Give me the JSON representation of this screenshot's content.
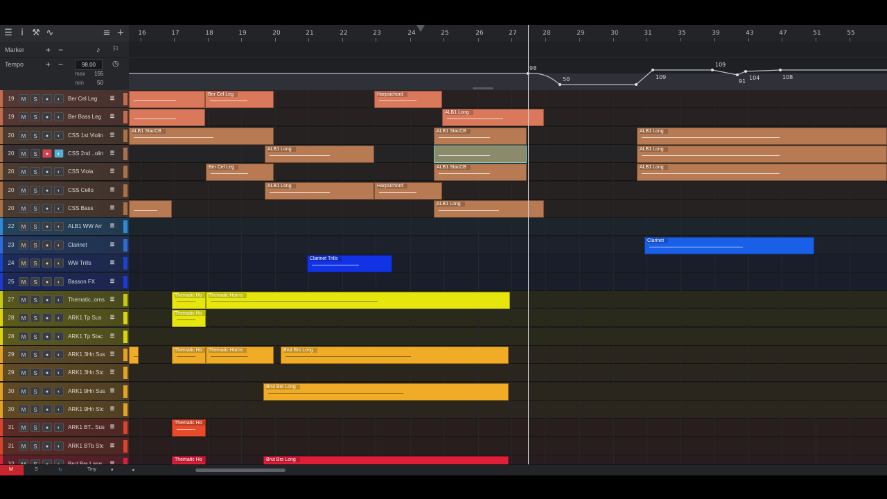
{
  "toolbar": {
    "icons": [
      "menu-icon",
      "info-icon",
      "wrench-icon",
      "automation-icon",
      "list-icon",
      "add-icon"
    ]
  },
  "ruler": {
    "bars": [
      "16",
      "17",
      "18",
      "19",
      "20",
      "21",
      "22",
      "23",
      "24",
      "25",
      "26",
      "27",
      "28",
      "29",
      "30",
      "31",
      "35",
      "39",
      "43",
      "47",
      "51",
      "55"
    ]
  },
  "globals": {
    "marker": {
      "label": "Marker",
      "add": "+",
      "remove": "−"
    },
    "tempo": {
      "label": "Tempo",
      "add": "+",
      "remove": "−",
      "value": "98.00",
      "max_label": "max",
      "max": "155",
      "min_label": "min",
      "min": "50"
    }
  },
  "tempo_points": [
    {
      "bar_label": "98"
    },
    {
      "bar_label": "50"
    },
    {
      "bar_label": "109"
    },
    {
      "bar_label": "109"
    },
    {
      "bar_label": "91"
    },
    {
      "bar_label": "104"
    },
    {
      "bar_label": "108"
    }
  ],
  "colors": {
    "orange_dark": "#d9785a",
    "orange_brown": "#b77a52",
    "blue": "#1452e6",
    "yellow": "#e6e60e",
    "gold": "#f0ac26",
    "red": "#e84a2a",
    "crimson": "#e01e3a"
  },
  "tracks": [
    {
      "num": "19",
      "name": "Ber Cel Leg",
      "color": "#c36a4f"
    },
    {
      "num": "19",
      "name": "Ber Bass Leg",
      "color": "#c36a4f"
    },
    {
      "num": "20",
      "name": "CSS 1st Violin",
      "color": "#a9714a"
    },
    {
      "num": "20",
      "name": "CSS 2nd ..olin",
      "color": "#a9714a"
    },
    {
      "num": "20",
      "name": "CSS Viola",
      "color": "#a9714a"
    },
    {
      "num": "20",
      "name": "CSS Cello",
      "color": "#a9714a"
    },
    {
      "num": "20",
      "name": "CSS Bass",
      "color": "#a9714a"
    },
    {
      "num": "22",
      "name": "ALB1 WW Arr",
      "color": "#2d8ad8"
    },
    {
      "num": "23",
      "name": "Clarinet",
      "color": "#2d6bd8"
    },
    {
      "num": "24",
      "name": "WW Trills",
      "color": "#1a44c8"
    },
    {
      "num": "25",
      "name": "Basson FX",
      "color": "#1a3ad0"
    },
    {
      "num": "27",
      "name": "Thematic..orns",
      "color": "#c8c812"
    },
    {
      "num": "28",
      "name": "ARK1 Tp Sus",
      "color": "#d9d40f"
    },
    {
      "num": "28",
      "name": "ARK1 Tp Stac",
      "color": "#d9d40f"
    },
    {
      "num": "29",
      "name": "ARK1 3Hn Sus",
      "color": "#e3a126"
    },
    {
      "num": "29",
      "name": "ARK1 3Hn Stc",
      "color": "#e3a126"
    },
    {
      "num": "30",
      "name": "ARK1 9Hn Sus",
      "color": "#e3a126"
    },
    {
      "num": "30",
      "name": "ARK1 9Hn Stc",
      "color": "#e3a126"
    },
    {
      "num": "31",
      "name": "ARK1 BT.. Sus",
      "color": "#d8442a"
    },
    {
      "num": "31",
      "name": "ARK1 BTb Stc",
      "color": "#d8442a"
    },
    {
      "num": "32",
      "name": "Brut Brs Long",
      "color": "#d8213a"
    }
  ],
  "track_buttons": {
    "mute": "M",
    "solo": "S",
    "record": "●",
    "monitor": "◐"
  },
  "clips": [
    {
      "row": 0,
      "name": "",
      "color": "#d9785a"
    },
    {
      "row": 0,
      "name": "Ber Cel Leg",
      "color": "#d9785a"
    },
    {
      "row": 0,
      "name": "Harpsichord",
      "color": "#d9785a"
    },
    {
      "row": 1,
      "name": "",
      "color": "#d9785a"
    },
    {
      "row": 1,
      "name": "ALB1 Long",
      "color": "#d9785a"
    },
    {
      "row": 2,
      "name": "ALB1 StacCB",
      "color": "#b77a52"
    },
    {
      "row": 2,
      "name": "ALB1 StacCB",
      "color": "#b77a52"
    },
    {
      "row": 2,
      "name": "ALB1 Long",
      "color": "#b77a52"
    },
    {
      "row": 3,
      "name": "ALB1 Long",
      "color": "#b77a52"
    },
    {
      "row": 3,
      "name": "",
      "color": "#b77a52"
    },
    {
      "row": 3,
      "name": "ALB1 Long",
      "color": "#b77a52"
    },
    {
      "row": 4,
      "name": "Ber Cel Leg",
      "color": "#b77a52"
    },
    {
      "row": 4,
      "name": "ALB1 StacCB",
      "color": "#b77a52"
    },
    {
      "row": 4,
      "name": "ALB1 Long",
      "color": "#b77a52"
    },
    {
      "row": 5,
      "name": "ALB1 Long",
      "color": "#b77a52"
    },
    {
      "row": 5,
      "name": "Harpsichord",
      "color": "#b77a52"
    },
    {
      "row": 6,
      "name": "",
      "color": "#b77a52"
    },
    {
      "row": 6,
      "name": "ALB1 Long",
      "color": "#b77a52"
    },
    {
      "row": 8,
      "name": "Clarinet",
      "color": "#1a5fe8"
    },
    {
      "row": 9,
      "name": "Clarinet Trills",
      "color": "#1232e6"
    },
    {
      "row": 11,
      "name": "Thematic Ho",
      "color": "#e6e60e"
    },
    {
      "row": 11,
      "name": "Thematic Horns",
      "color": "#e6e60e"
    },
    {
      "row": 12,
      "name": "Thematic Ho",
      "color": "#e6e60e"
    },
    {
      "row": 14,
      "name": "",
      "color": "#f0ac26"
    },
    {
      "row": 14,
      "name": "Thematic Ho",
      "color": "#f0ac26"
    },
    {
      "row": 14,
      "name": "Thematic Horns",
      "color": "#f0ac26"
    },
    {
      "row": 14,
      "name": "Brut Brs Long",
      "color": "#f0ac26"
    },
    {
      "row": 16,
      "name": "Brut Brs Long",
      "color": "#f0ac26"
    },
    {
      "row": 18,
      "name": "Thematic Ho",
      "color": "#e84a2a"
    },
    {
      "row": 20,
      "name": "Thematic Ho",
      "color": "#e01e3a"
    },
    {
      "row": 20,
      "name": "Brut Brs Long",
      "color": "#e01e3a"
    }
  ],
  "bottom": {
    "m": "M",
    "s": "S",
    "sync": "↻",
    "zoom": "Tiny",
    "zoom_arrow": "▾",
    "scroll_left": "◂"
  }
}
